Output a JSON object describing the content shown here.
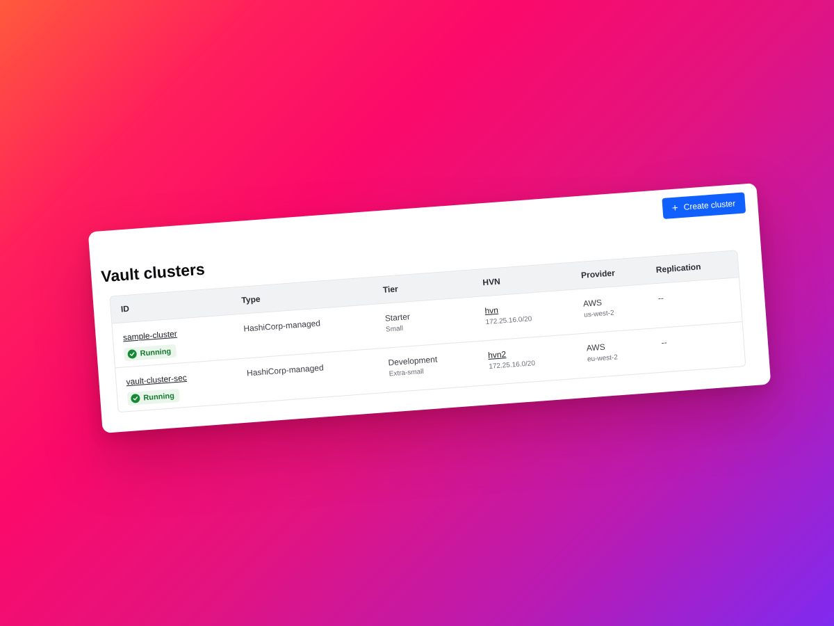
{
  "page": {
    "title": "Vault clusters",
    "create_button": "Create cluster"
  },
  "table": {
    "columns": [
      "ID",
      "Type",
      "Tier",
      "HVN",
      "Provider",
      "Replication"
    ],
    "rows": [
      {
        "id": "sample-cluster",
        "status": "Running",
        "type": "HashiCorp-managed",
        "tier": "Starter",
        "tier_size": "Small",
        "hvn": "hvn",
        "hvn_cidr": "172.25.16.0/20",
        "provider": "AWS",
        "region": "us-west-2",
        "replication": "--"
      },
      {
        "id": "vault-cluster-sec",
        "status": "Running",
        "type": "HashiCorp-managed",
        "tier": "Development",
        "tier_size": "Extra-small",
        "hvn": "hvn2",
        "hvn_cidr": "172.25.16.0/20",
        "provider": "AWS",
        "region": "eu-west-2",
        "replication": "--"
      }
    ]
  },
  "colors": {
    "primary_button": "#1060ff",
    "status_running": "#158a34",
    "status_running_bg": "#eaf6ec"
  },
  "icons": {
    "create": "plus-icon",
    "status": "check-circle-icon"
  }
}
